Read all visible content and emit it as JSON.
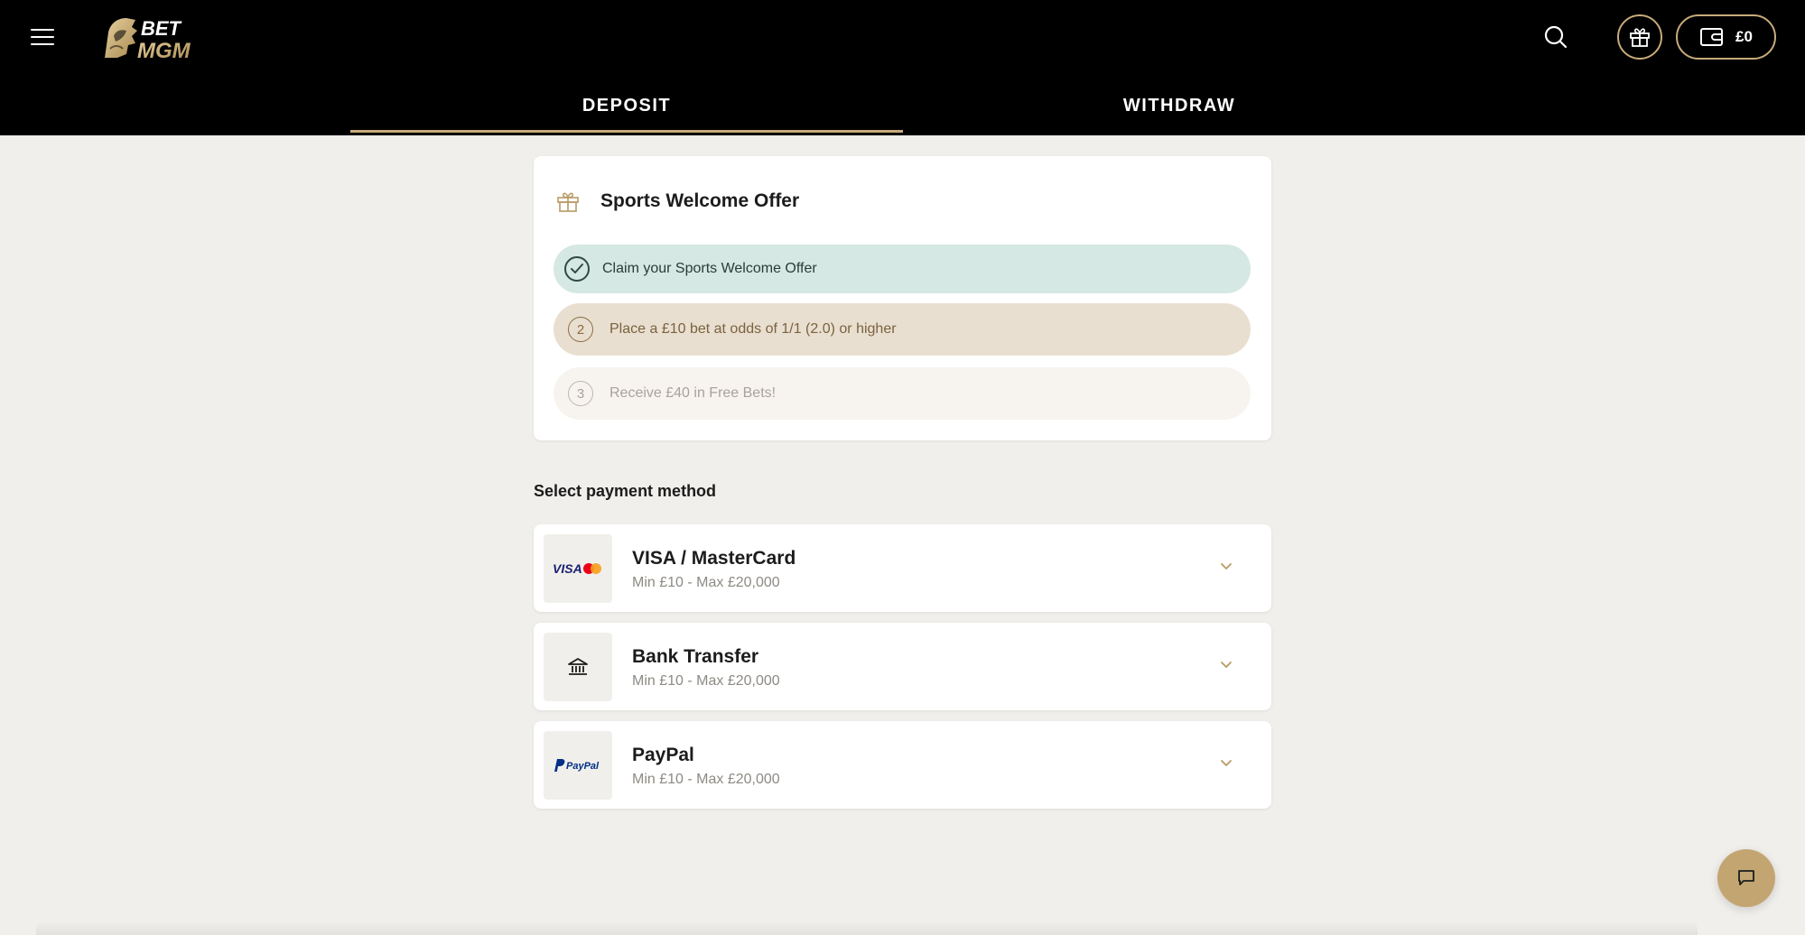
{
  "brand": {
    "logo_text_top": "BET",
    "logo_text_bottom": "MGM",
    "accent": "#c7ab7a"
  },
  "header": {
    "menu_icon": "hamburger-menu-icon",
    "search_icon": "search-icon",
    "gift_icon": "gift-icon",
    "wallet_icon": "wallet-icon",
    "wallet_balance": "£0"
  },
  "tabs": [
    {
      "label": "DEPOSIT",
      "active": true
    },
    {
      "label": "WITHDRAW",
      "active": false
    }
  ],
  "welcome_offer": {
    "title": "Sports Welcome Offer",
    "icon": "gift-icon",
    "steps": [
      {
        "badge": "check",
        "text": "Claim your Sports Welcome Offer",
        "state": "done"
      },
      {
        "badge": "2",
        "text": "Place a £10 bet at odds of 1/1 (2.0) or higher",
        "state": "current"
      },
      {
        "badge": "3",
        "text": "Receive £40 in Free Bets!",
        "state": "pending"
      }
    ]
  },
  "payment": {
    "section_label": "Select payment method",
    "methods": [
      {
        "name": "VISA / MasterCard",
        "limits": "Min £10 - Max £20,000",
        "logo_text": "VISA",
        "icon": "visa-mastercard-logo"
      },
      {
        "name": "Bank Transfer",
        "limits": "Min £10 - Max £20,000",
        "icon": "bank-icon"
      },
      {
        "name": "PayPal",
        "limits": "Min £10 - Max £20,000",
        "logo_text": "PayPal",
        "icon": "paypal-logo"
      }
    ]
  },
  "chat": {
    "icon": "chat-icon"
  }
}
